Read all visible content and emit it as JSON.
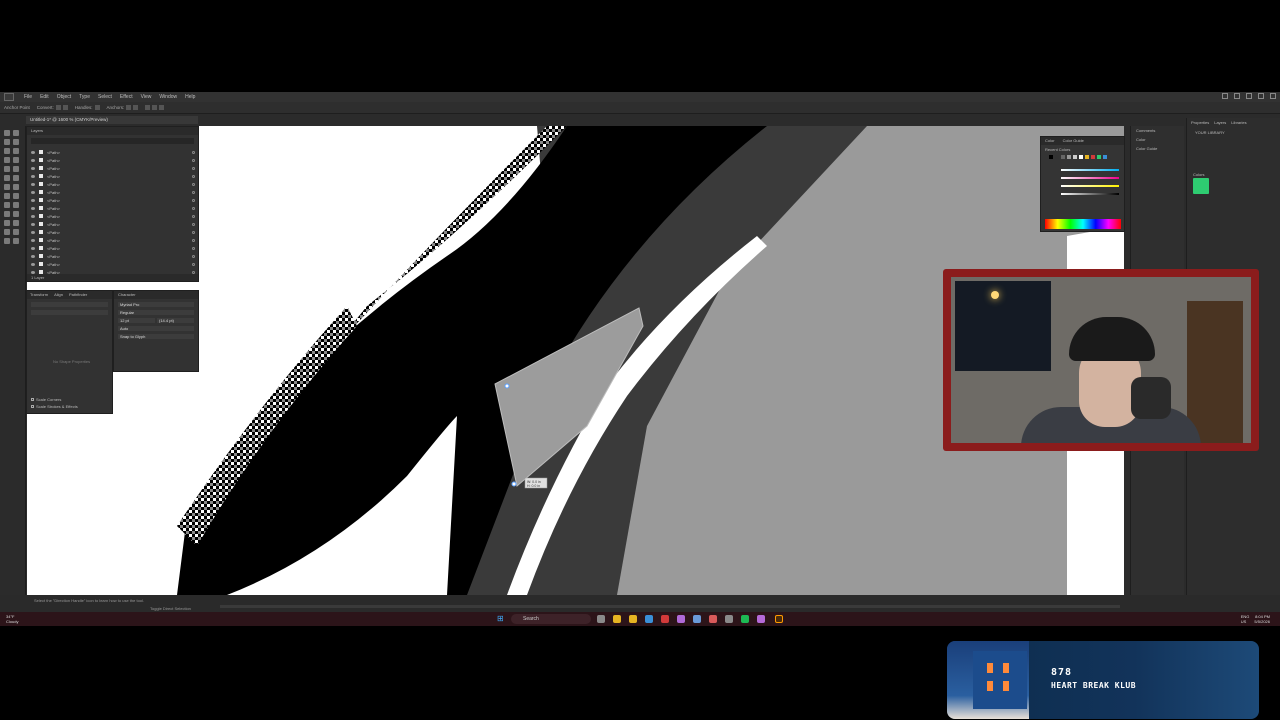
{
  "app": {
    "menu": [
      "File",
      "Edit",
      "Object",
      "Type",
      "Select",
      "Effect",
      "View",
      "Window",
      "Help"
    ],
    "control_bar": [
      "Anchor Point",
      "Convert:",
      "Handles:",
      "Anchors:"
    ],
    "doc_tab": "Untitled-1* @ 1600 % (CMYK/Preview)",
    "layers_panel": {
      "tab": "Layers",
      "rows": [
        "<Path>",
        "<Path>",
        "<Path>",
        "<Path>",
        "<Path>",
        "<Path>",
        "<Path>",
        "<Path>",
        "<Path>",
        "<Path>",
        "<Path>",
        "<Path>",
        "<Path>",
        "<Path>",
        "<Path>",
        "<Path>"
      ],
      "footer": "1 Layer"
    },
    "transform_panel": {
      "tabs": [
        "Transform",
        "Align",
        "Pathfinder"
      ],
      "hint": "No Shape Properties",
      "options": [
        "Scale Corners",
        "Scale Strokes & Effects"
      ]
    },
    "character_panel": {
      "tab": "Character",
      "font": "Myriad Pro",
      "style": "Regular",
      "size": "12 pt",
      "leading": "(14.4 pt)",
      "tracking": "Auto",
      "snap": "Snap to Glyph"
    },
    "color_panel": {
      "tabs": [
        "Color",
        "Color Guide"
      ],
      "recent": "Recent Colors"
    },
    "right_panels": [
      "Comments",
      "Color",
      "Color Guide"
    ],
    "libraries": {
      "tabs": [
        "Properties",
        "Layers",
        "Libraries"
      ],
      "title": "YOUR LIBRARY",
      "section": "Colors",
      "swatch_color": "#2ecc71"
    },
    "statusbar": {
      "hint": "Select the \"Direction Handle\" icon to learn how to use the tool.",
      "mode": "Toggle Direct Selection"
    },
    "measure": {
      "w": "W: 0.0 in",
      "h": "H: 0.0 in"
    }
  },
  "taskbar": {
    "weather_temp": "34°F",
    "weather_desc": "Cloudy",
    "search_placeholder": "Search",
    "lang": "ENG",
    "region": "US",
    "time": "8:04 PM",
    "date": "5/5/2026"
  },
  "now_playing": {
    "number": "878",
    "title": "HEART BREAK KLUB"
  }
}
